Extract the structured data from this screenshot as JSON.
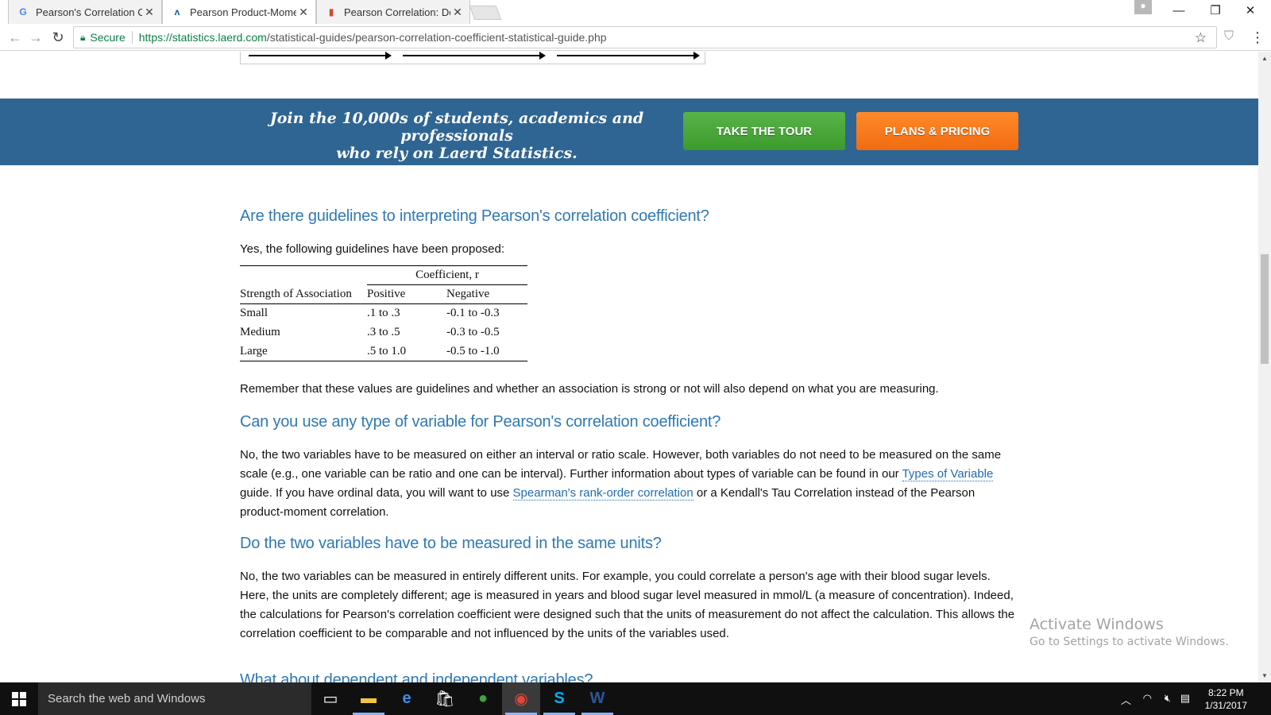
{
  "browser": {
    "tabs": [
      {
        "title": "Pearson's Correlation Co",
        "favicon": "G",
        "active": false
      },
      {
        "title": "Pearson Product-Momen",
        "favicon": "laerd",
        "active": true
      },
      {
        "title": "Pearson Correlation: Defi",
        "favicon": "chart",
        "active": false
      }
    ],
    "address": {
      "secure_label": "Secure",
      "url_host": "https://statistics.laerd.com",
      "url_path": "/statistical-guides/pearson-correlation-coefficient-statistical-guide.php"
    }
  },
  "banner": {
    "tagline_line1": "Join the 10,000s of students, academics and professionals",
    "tagline_line2": "who rely on Laerd Statistics.",
    "tour_button": "TAKE THE TOUR",
    "pricing_button": "PLANS & PRICING",
    "tour_color": "#4caf3a",
    "pricing_color": "#f77a1f"
  },
  "article": {
    "q1_heading": "Are there guidelines to interpreting Pearson's correlation coefficient?",
    "q1_intro": "Yes, the following guidelines have been proposed:",
    "table": {
      "group_header": "Coefficient, r",
      "col_strength": "Strength of Association",
      "col_positive": "Positive",
      "col_negative": "Negative",
      "rows": [
        {
          "strength": "Small",
          "positive": ".1 to .3",
          "negative": "-0.1 to -0.3"
        },
        {
          "strength": "Medium",
          "positive": ".3 to .5",
          "negative": "-0.3 to -0.5"
        },
        {
          "strength": "Large",
          "positive": ".5 to 1.0",
          "negative": "-0.5 to -1.0"
        }
      ]
    },
    "q1_note": "Remember that these values are guidelines and whether an association is strong or not will also depend on what you are measuring.",
    "q2_heading": "Can you use any type of variable for Pearson's correlation coefficient?",
    "q2_p_part1": "No, the two variables have to be measured on either an interval or ratio scale. However, both variables do not need to be measured on the same scale (e.g., one variable can be ratio and one can be interval). Further information about types of variable can be found in our ",
    "q2_link1": "Types of Variable",
    "q2_p_part2": " guide. If you have ordinal data, you will want to use ",
    "q2_link2": "Spearman's rank-order correlation",
    "q2_p_part3": " or a Kendall's Tau Correlation instead of the Pearson product-moment correlation.",
    "q3_heading": "Do the two variables have to be measured in the same units?",
    "q3_p": "No, the two variables can be measured in entirely different units. For example, you could correlate a person's age with their blood sugar levels. Here, the units are completely different; age is measured in years and blood sugar level measured in mmol/L (a measure of concentration). Indeed, the calculations for Pearson's correlation coefficient were designed such that the units of measurement do not affect the calculation. This allows the correlation coefficient to be comparable and not influenced by the units of the variables used.",
    "q4_heading": "What about dependent and independent variables?"
  },
  "watermark": {
    "line1": "Activate Windows",
    "line2": "Go to Settings to activate Windows."
  },
  "taskbar": {
    "search_placeholder": "Search the web and Windows",
    "time": "8:22 PM",
    "date": "1/31/2017"
  }
}
